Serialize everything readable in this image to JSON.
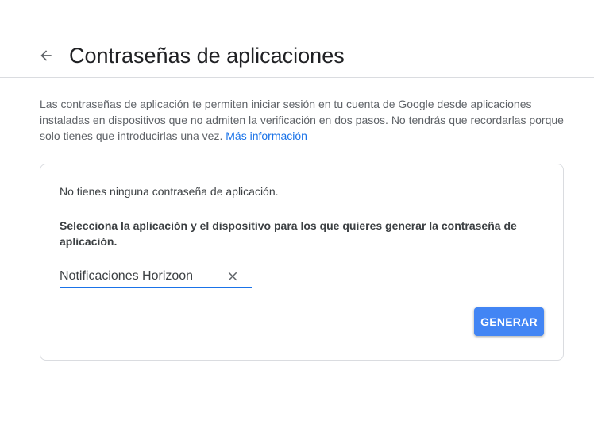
{
  "header": {
    "title": "Contraseñas de aplicaciones",
    "back_icon": "arrow-back-icon"
  },
  "intro": {
    "text": "Las contraseñas de aplicación te permiten iniciar sesión en tu cuenta de Google desde aplicaciones instaladas en dispositivos que no admiten la verificación en dos pasos. No tendrás que recordarlas porque solo tienes que introducirlas una vez. ",
    "link_label": "Más información"
  },
  "card": {
    "empty_message": "No tienes ninguna contraseña de aplicación.",
    "instruction": "Selecciona la aplicación y el dispositivo para los que quieres generar la contraseña de aplicación.",
    "app_name_value": "Notificaciones Horizoon",
    "clear_icon": "close-icon",
    "generate_label": "GENERAR"
  },
  "colors": {
    "accent": "#1a73e8",
    "button": "#4285f4",
    "text_secondary": "#5f6368",
    "divider": "#dadce0"
  }
}
